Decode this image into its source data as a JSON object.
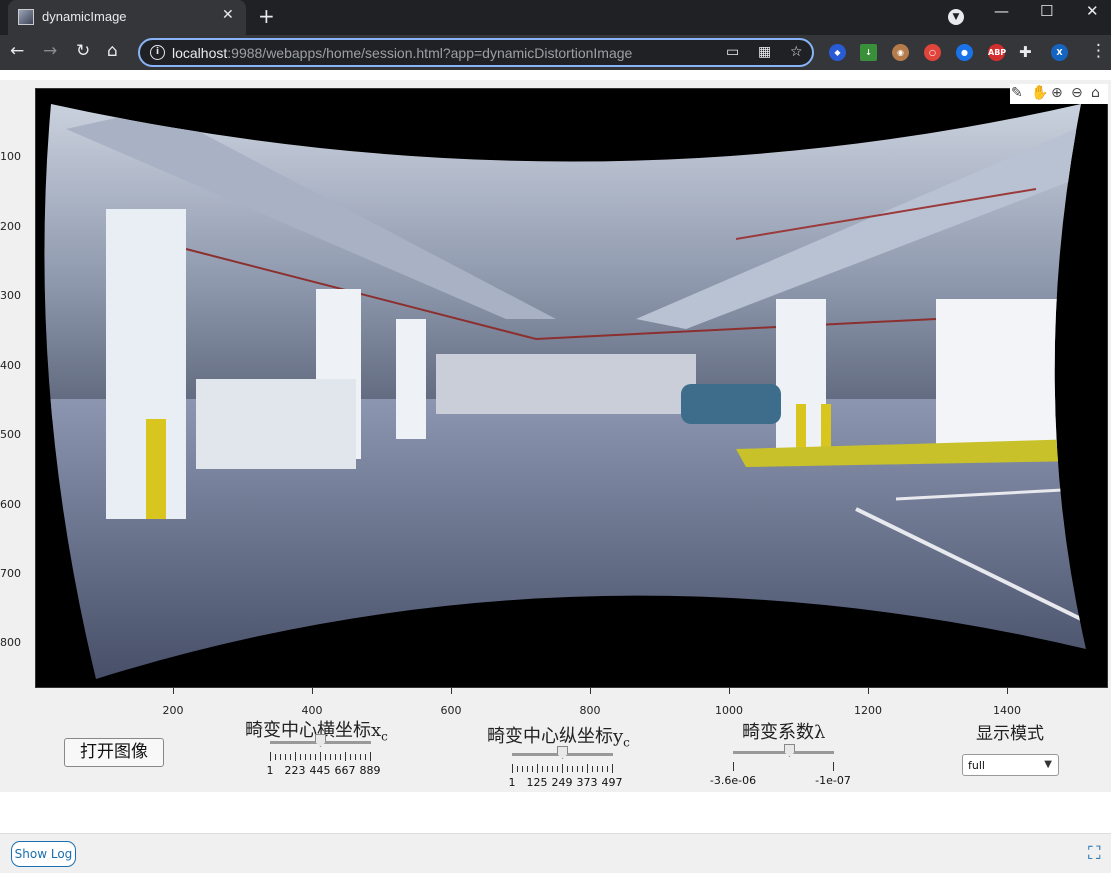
{
  "browser": {
    "tab_title": "dynamicImage",
    "tab_close": "✕",
    "new_tab": "+",
    "url_host": "localhost",
    "url_rest": ":9988/webapps/home/session.html?app=dynamicDistortionImage",
    "icons": [
      "back-icon",
      "forward-icon",
      "reload-icon",
      "home-icon",
      "info-icon",
      "cast-icon",
      "qr-icon",
      "star-icon",
      "puzzle-icon",
      "profile-icon",
      "menu-icon"
    ],
    "profile_initial": "X",
    "ext_abp": "ABP"
  },
  "plot": {
    "y_ticks": [
      "100",
      "200",
      "300",
      "400",
      "500",
      "600",
      "700",
      "800"
    ],
    "x_ticks": [
      "200",
      "400",
      "600",
      "800",
      "1000",
      "1200",
      "1400"
    ],
    "toolbar_icons": [
      "brush-icon",
      "pan-icon",
      "zoom-in-icon",
      "zoom-out-icon",
      "home-icon"
    ]
  },
  "controls": {
    "open_button": "打开图像",
    "xc": {
      "label": "畸变中心横坐标x",
      "sub": "c",
      "ticks": [
        "1",
        "223",
        "445",
        "667",
        "889"
      ],
      "value_fraction": 0.5
    },
    "yc": {
      "label": "畸变中心纵坐标y",
      "sub": "c",
      "ticks": [
        "1",
        "125",
        "249",
        "373",
        "497"
      ],
      "value_fraction": 0.5
    },
    "lambda": {
      "label": "畸变系数λ",
      "min_label": "-3.6e-06",
      "max_label": "-1e-07",
      "value_fraction": 0.55
    },
    "display_mode": {
      "label": "显示模式",
      "selected": "full"
    }
  },
  "footer": {
    "show_log": "Show Log"
  }
}
